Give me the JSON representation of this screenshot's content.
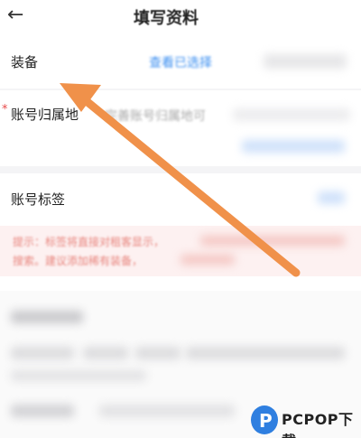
{
  "header": {
    "back_glyph": "←",
    "title": "填写资料"
  },
  "fields": {
    "equipment": {
      "label": "装备",
      "link": "查看已选择"
    },
    "account_region": {
      "required_mark": "*",
      "label": "账号归属地",
      "placeholder": "完善账号归属地可"
    },
    "account_tags": {
      "label": "账号标签"
    }
  },
  "tip": {
    "line1": "提示：标签将直接对租客显示，",
    "line2": "搜索。建议添加稀有装备，"
  },
  "watermark": {
    "brand": "PCPOP下载",
    "letter": "P"
  },
  "colors": {
    "accent_blue": "#3a8ef0",
    "arrow_orange": "#f0914a",
    "tip_red": "#e8867f"
  }
}
